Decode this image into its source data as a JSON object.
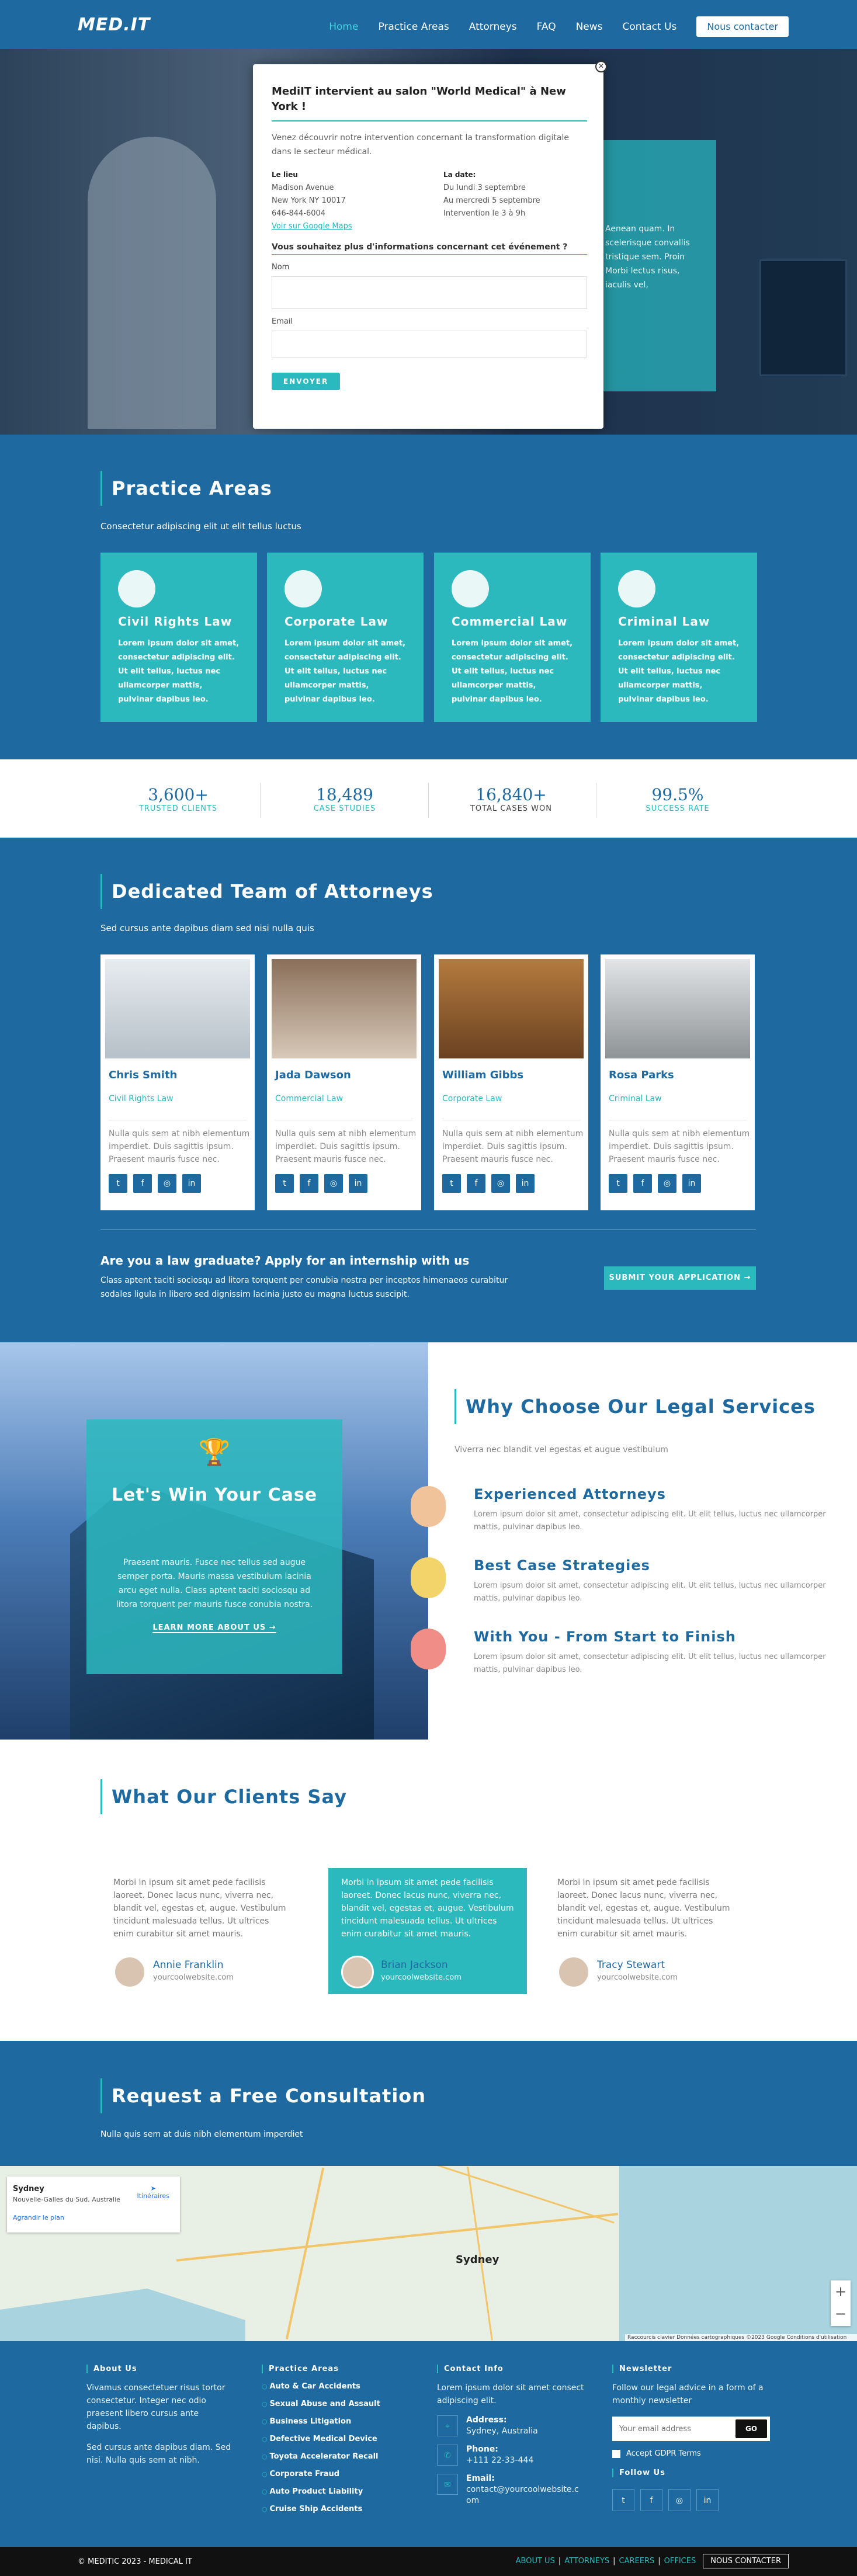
{
  "header": {
    "logo": "MED.IT",
    "nav": [
      "Home",
      "Practice Areas",
      "Attorneys",
      "FAQ",
      "News",
      "Contact Us"
    ],
    "cta": "Nous contacter"
  },
  "hero": {
    "text": "Aenean quam. In scelerisque convallis tristique sem. Proin Morbi lectus risus, iaculis vel,"
  },
  "modal": {
    "title": "MediIT intervient au salon \"World Medical\" à New York !",
    "lead": "Venez découvrir notre intervention concernant la transformation digitale dans le secteur médical.",
    "place_title": "Le lieu",
    "place": [
      "Madison Avenue",
      "New York NY 10017",
      "646-844-6004"
    ],
    "map_link": "Voir sur Google Maps",
    "date_title": "La date:",
    "date": [
      "Du lundi 3 septembre",
      "Au mercredi 5 septembre",
      "Intervention le 3 à 9h"
    ],
    "question": "Vous souhaitez plus d'informations concernant cet événement ?",
    "name_label": "Nom",
    "email_label": "Email",
    "submit": "ENVOYER"
  },
  "practice": {
    "title": "Practice Areas",
    "subtitle": "Consectetur adipiscing elit ut elit tellus luctus",
    "cards": [
      {
        "title": "Civil Rights Law",
        "icon": "dove-icon",
        "text": "Lorem ipsum dolor sit amet, consectetur adipiscing elit. Ut elit tellus, luctus nec ullamcorper mattis, pulvinar dapibus leo."
      },
      {
        "title": "Corporate Law",
        "icon": "scales-icon",
        "text": "Lorem ipsum dolor sit amet, consectetur adipiscing elit. Ut elit tellus, luctus nec ullamcorper mattis, pulvinar dapibus leo."
      },
      {
        "title": "Commercial Law",
        "icon": "shield-icon",
        "text": "Lorem ipsum dolor sit amet, consectetur adipiscing elit. Ut elit tellus, luctus nec ullamcorper mattis, pulvinar dapibus leo."
      },
      {
        "title": "Criminal Law",
        "icon": "gavel-icon",
        "text": "Lorem ipsum dolor sit amet, consectetur adipiscing elit. Ut elit tellus, luctus nec ullamcorper mattis, pulvinar dapibus leo."
      }
    ]
  },
  "stats": [
    {
      "value": "3,600+",
      "label": "TRUSTED CLIENTS"
    },
    {
      "value": "18,489",
      "label": "CASE STUDIES"
    },
    {
      "value": "16,840+",
      "label": "TOTAL CASES WON"
    },
    {
      "value": "99.5%",
      "label": "SUCCESS RATE"
    }
  ],
  "team": {
    "title": "Dedicated Team of Attorneys",
    "subtitle": "Sed cursus ante dapibus diam sed nisi nulla quis",
    "members": [
      {
        "name": "Chris Smith",
        "role": "Civil Rights Law",
        "bio": "Nulla quis sem at nibh elementum imperdiet. Duis sagittis ipsum. Praesent mauris fusce nec."
      },
      {
        "name": "Jada Dawson",
        "role": "Commercial Law",
        "bio": "Nulla quis sem at nibh elementum imperdiet. Duis sagittis ipsum. Praesent mauris fusce nec."
      },
      {
        "name": "William Gibbs",
        "role": "Corporate Law",
        "bio": "Nulla quis sem at nibh elementum imperdiet. Duis sagittis ipsum. Praesent mauris fusce nec."
      },
      {
        "name": "Rosa Parks",
        "role": "Criminal Law",
        "bio": "Nulla quis sem at nibh elementum imperdiet. Duis sagittis ipsum. Praesent mauris fusce nec."
      }
    ],
    "social_icons": [
      "twitter-icon",
      "facebook-icon",
      "instagram-icon",
      "linkedin-icon"
    ]
  },
  "internship": {
    "title": "Are you a law graduate? Apply for an internship with us",
    "text": "Class aptent taciti sociosqu ad litora torquent per conubia nostra per inceptos himenaeos curabitur sodales ligula in libero sed dignissim lacinia justo eu magna luctus suscipit.",
    "button": "SUBMIT YOUR APPLICATION"
  },
  "why": {
    "box_title": "Let's Win Your Case",
    "box_text": "Praesent mauris. Fusce nec tellus sed augue semper porta. Mauris massa vestibulum lacinia arcu eget nulla. Class aptent taciti sociosqu ad litora torquent per mauris fusce conubia nostra.",
    "box_link": "LEARN MORE ABOUT US",
    "title": "Why Choose Our Legal Services",
    "subtitle": "Viverra nec blandit vel egestas et augue vestibulum",
    "features": [
      {
        "title": "Experienced Attorneys",
        "text": "Lorem ipsum dolor sit amet, consectetur adipiscing elit. Ut elit tellus, luctus nec ullamcorper mattis, pulvinar dapibus leo."
      },
      {
        "title": "Best Case Strategies",
        "text": "Lorem ipsum dolor sit amet, consectetur adipiscing elit. Ut elit tellus, luctus nec ullamcorper mattis, pulvinar dapibus leo."
      },
      {
        "title": "With You - From Start to Finish",
        "text": "Lorem ipsum dolor sit amet, consectetur adipiscing elit. Ut elit tellus, luctus nec ullamcorper mattis, pulvinar dapibus leo."
      }
    ]
  },
  "testimonials": {
    "title": "What Our Clients Say",
    "items": [
      {
        "text": "Morbi in ipsum sit amet pede facilisis laoreet. Donec lacus nunc, viverra nec, blandit vel, egestas et, augue. Vestibulum tincidunt malesuada tellus. Ut ultrices enim curabitur sit amet mauris.",
        "name": "Annie Franklin",
        "site": "yourcoolwebsite.com"
      },
      {
        "text": "Morbi in ipsum sit amet pede facilisis laoreet. Donec lacus nunc, viverra nec, blandit vel, egestas et, augue. Vestibulum tincidunt malesuada tellus. Ut ultrices enim curabitur sit amet mauris.",
        "name": "Brian Jackson",
        "site": "yourcoolwebsite.com"
      },
      {
        "text": "Morbi in ipsum sit amet pede facilisis laoreet. Donec lacus nunc, viverra nec, blandit vel, egestas et, augue. Vestibulum tincidunt malesuada tellus. Ut ultrices enim curabitur sit amet mauris.",
        "name": "Tracy Stewart",
        "site": "yourcoolwebsite.com"
      }
    ]
  },
  "consultation": {
    "title": "Request a Free Consultation",
    "subtitle": "Nulla quis sem at duis nibh elementum imperdiet"
  },
  "map": {
    "place": "Sydney",
    "address": "Nouvelle-Galles du Sud, Australie",
    "directions": "Itinéraires",
    "enlarge": "Agrandir le plan",
    "city_label": "Sydney",
    "attribution": "Raccourcis clavier   Données cartographiques ©2023 Google   Conditions d'utilisation",
    "zoom_in": "+",
    "zoom_out": "−"
  },
  "footer": {
    "about_title": "About Us",
    "about_text1": "Vivamus consectetuer risus tortor consectetur. Integer nec odio praesent libero cursus ante dapibus.",
    "about_text2": "Sed cursus ante dapibus diam. Sed nisi. Nulla quis sem at nibh.",
    "practice_title": "Practice Areas",
    "practice_items": [
      "Auto & Car Accidents",
      "Sexual Abuse and Assault",
      "Business Litigation",
      "Defective Medical Device",
      "Toyota Accelerator Recall",
      "Corporate Fraud",
      "Auto Product Liability",
      "Cruise Ship Accidents"
    ],
    "contact_title": "Contact Info",
    "contact_text": "Lorem ipsum dolor sit amet consect adipiscing elit.",
    "address_label": "Address:",
    "address": "Sydney, Australia",
    "phone_label": "Phone:",
    "phone": "+111 22-33-444",
    "email_label": "Email:",
    "email": "contact@yourcoolwebsite.com",
    "newsletter_title": "Newsletter",
    "newsletter_text": "Follow our legal advice in a form of a monthly newsletter",
    "newsletter_placeholder": "Your email address",
    "newsletter_button": "GO",
    "gdpr": "Accept GDPR Terms",
    "follow_title": "Follow Us"
  },
  "bottom": {
    "copyright": "© MEDITIC 2023 - MEDICAL IT",
    "links": [
      "ABOUT US",
      "ATTORNEYS",
      "CAREERS",
      "OFFICES"
    ],
    "button": "NOUS CONTACTER"
  },
  "colors": {
    "primary": "#1e6aa0",
    "accent": "#2bb9be",
    "dark": "#111111"
  }
}
